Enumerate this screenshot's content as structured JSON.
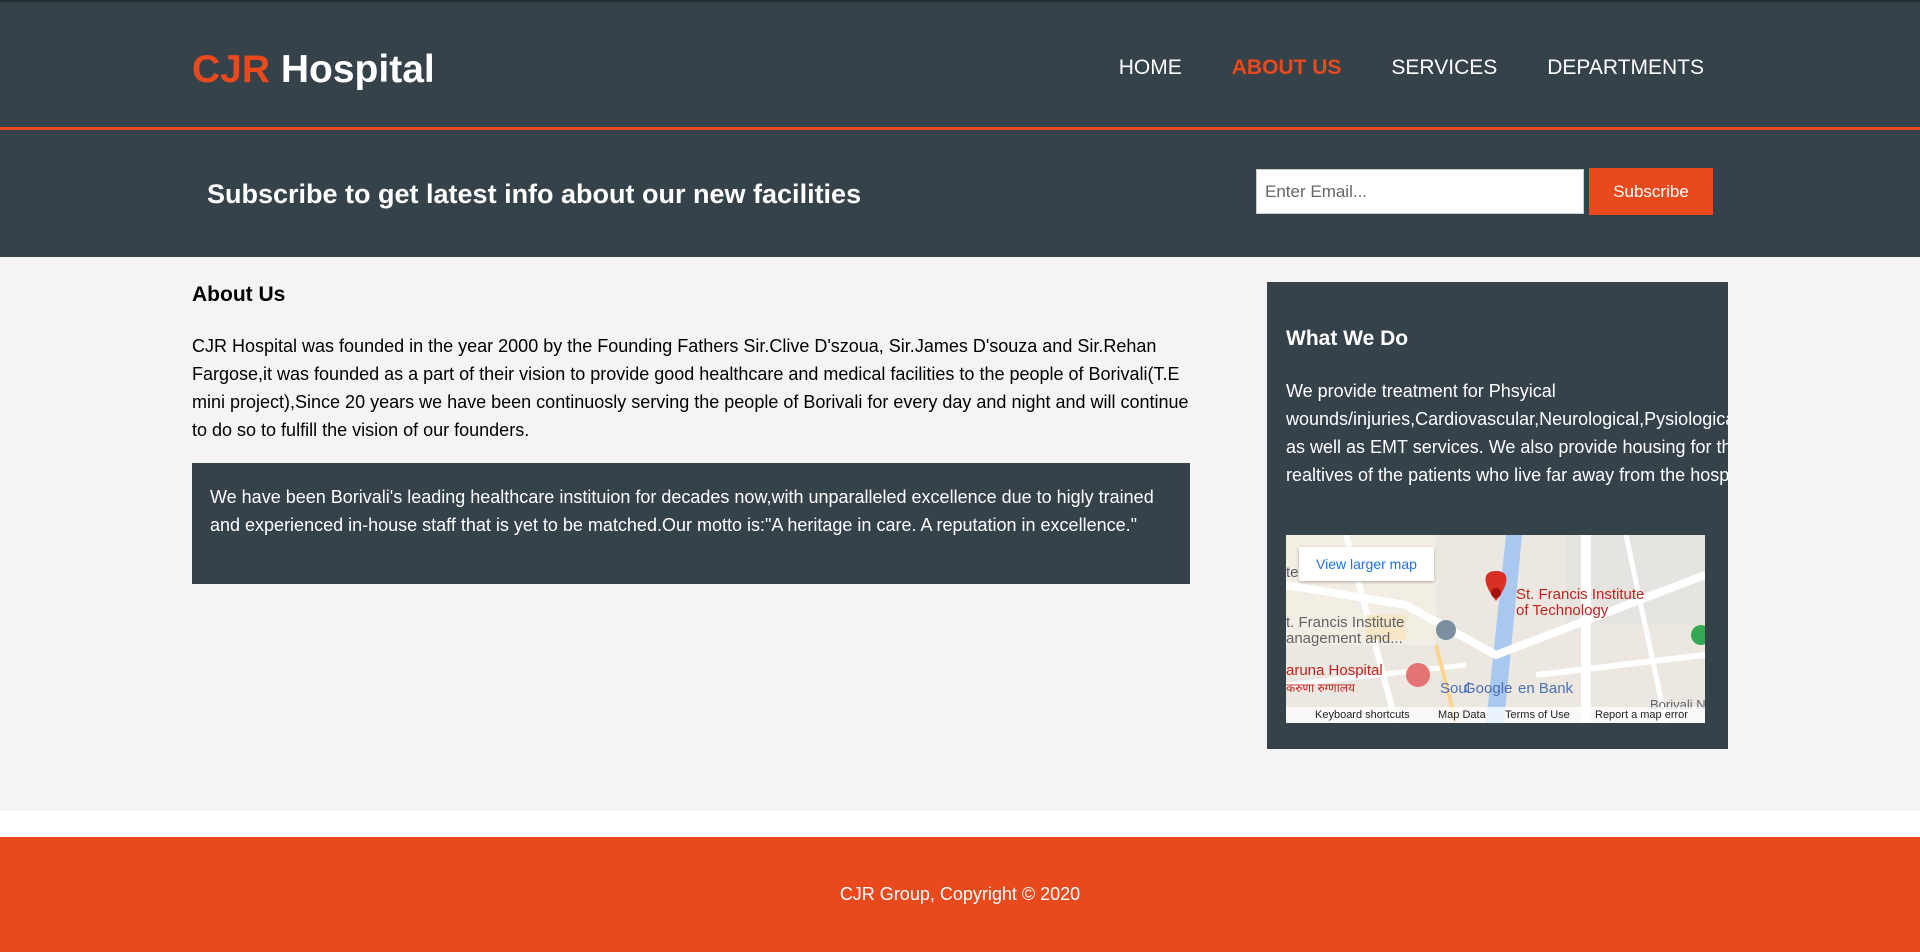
{
  "header": {
    "logo_accent": "CJR",
    "logo_rest": "Hospital",
    "nav": [
      "HOME",
      "ABOUT US",
      "SERVICES",
      "DEPARTMENTS"
    ],
    "active_nav": "ABOUT US"
  },
  "newsletter": {
    "heading": "Subscribe to get latest info about our new facilities",
    "email_placeholder": "Enter Email...",
    "subscribe_label": "Subscribe"
  },
  "about": {
    "title": "About Us",
    "text": "CJR Hospital was founded in the year 2000 by the Founding Fathers Sir.Clive D'szoua, Sir.James D'souza and Sir.Rehan Fargose,it was founded as a part of their vision to provide good healthcare and medical facilities to the people of Borivali(T.E mini project),Since 20 years we have been continuosly serving the people of Borivali for every day and night and will continue to do so to fulfill the vision of our founders.",
    "highlight": "We have been Borivali's leading healthcare instituion for decades now,with unparalleled excellence due to higly trained and experienced in-house staff that is yet to be matched.Our motto is:\"A heritage in care. A reputation in excellence.\""
  },
  "sidebar": {
    "title": "What We Do",
    "text": "We provide treatment for Phsyical wounds/injuries,Cardiovascular,Neurological,Pysiological as well as EMT services. We also provide housing for the realtives of the patients who live far away from the hospital",
    "map": {
      "larger_map": "View larger map",
      "place_1": "St. Francis Institute",
      "place_1b": "of Technology",
      "place_2": "t. Francis Institute",
      "place_2b": "anagement and...",
      "place_3": "aruna Hospital",
      "place_3b": "करुणा रुग्णालय",
      "place_4": "Soul",
      "place_5": "en Bank",
      "place_6": "Borivali N",
      "place_7": "te",
      "google": "Google",
      "footer_links": [
        "Keyboard shortcuts",
        "Map Data",
        "Terms of Use",
        "Report a map error"
      ]
    }
  },
  "footer": {
    "text": "CJR Group, Copyright © 2020"
  },
  "colors": {
    "dark": "#35424a",
    "accent": "#e8491d",
    "light_bg": "#f4f4f4"
  }
}
